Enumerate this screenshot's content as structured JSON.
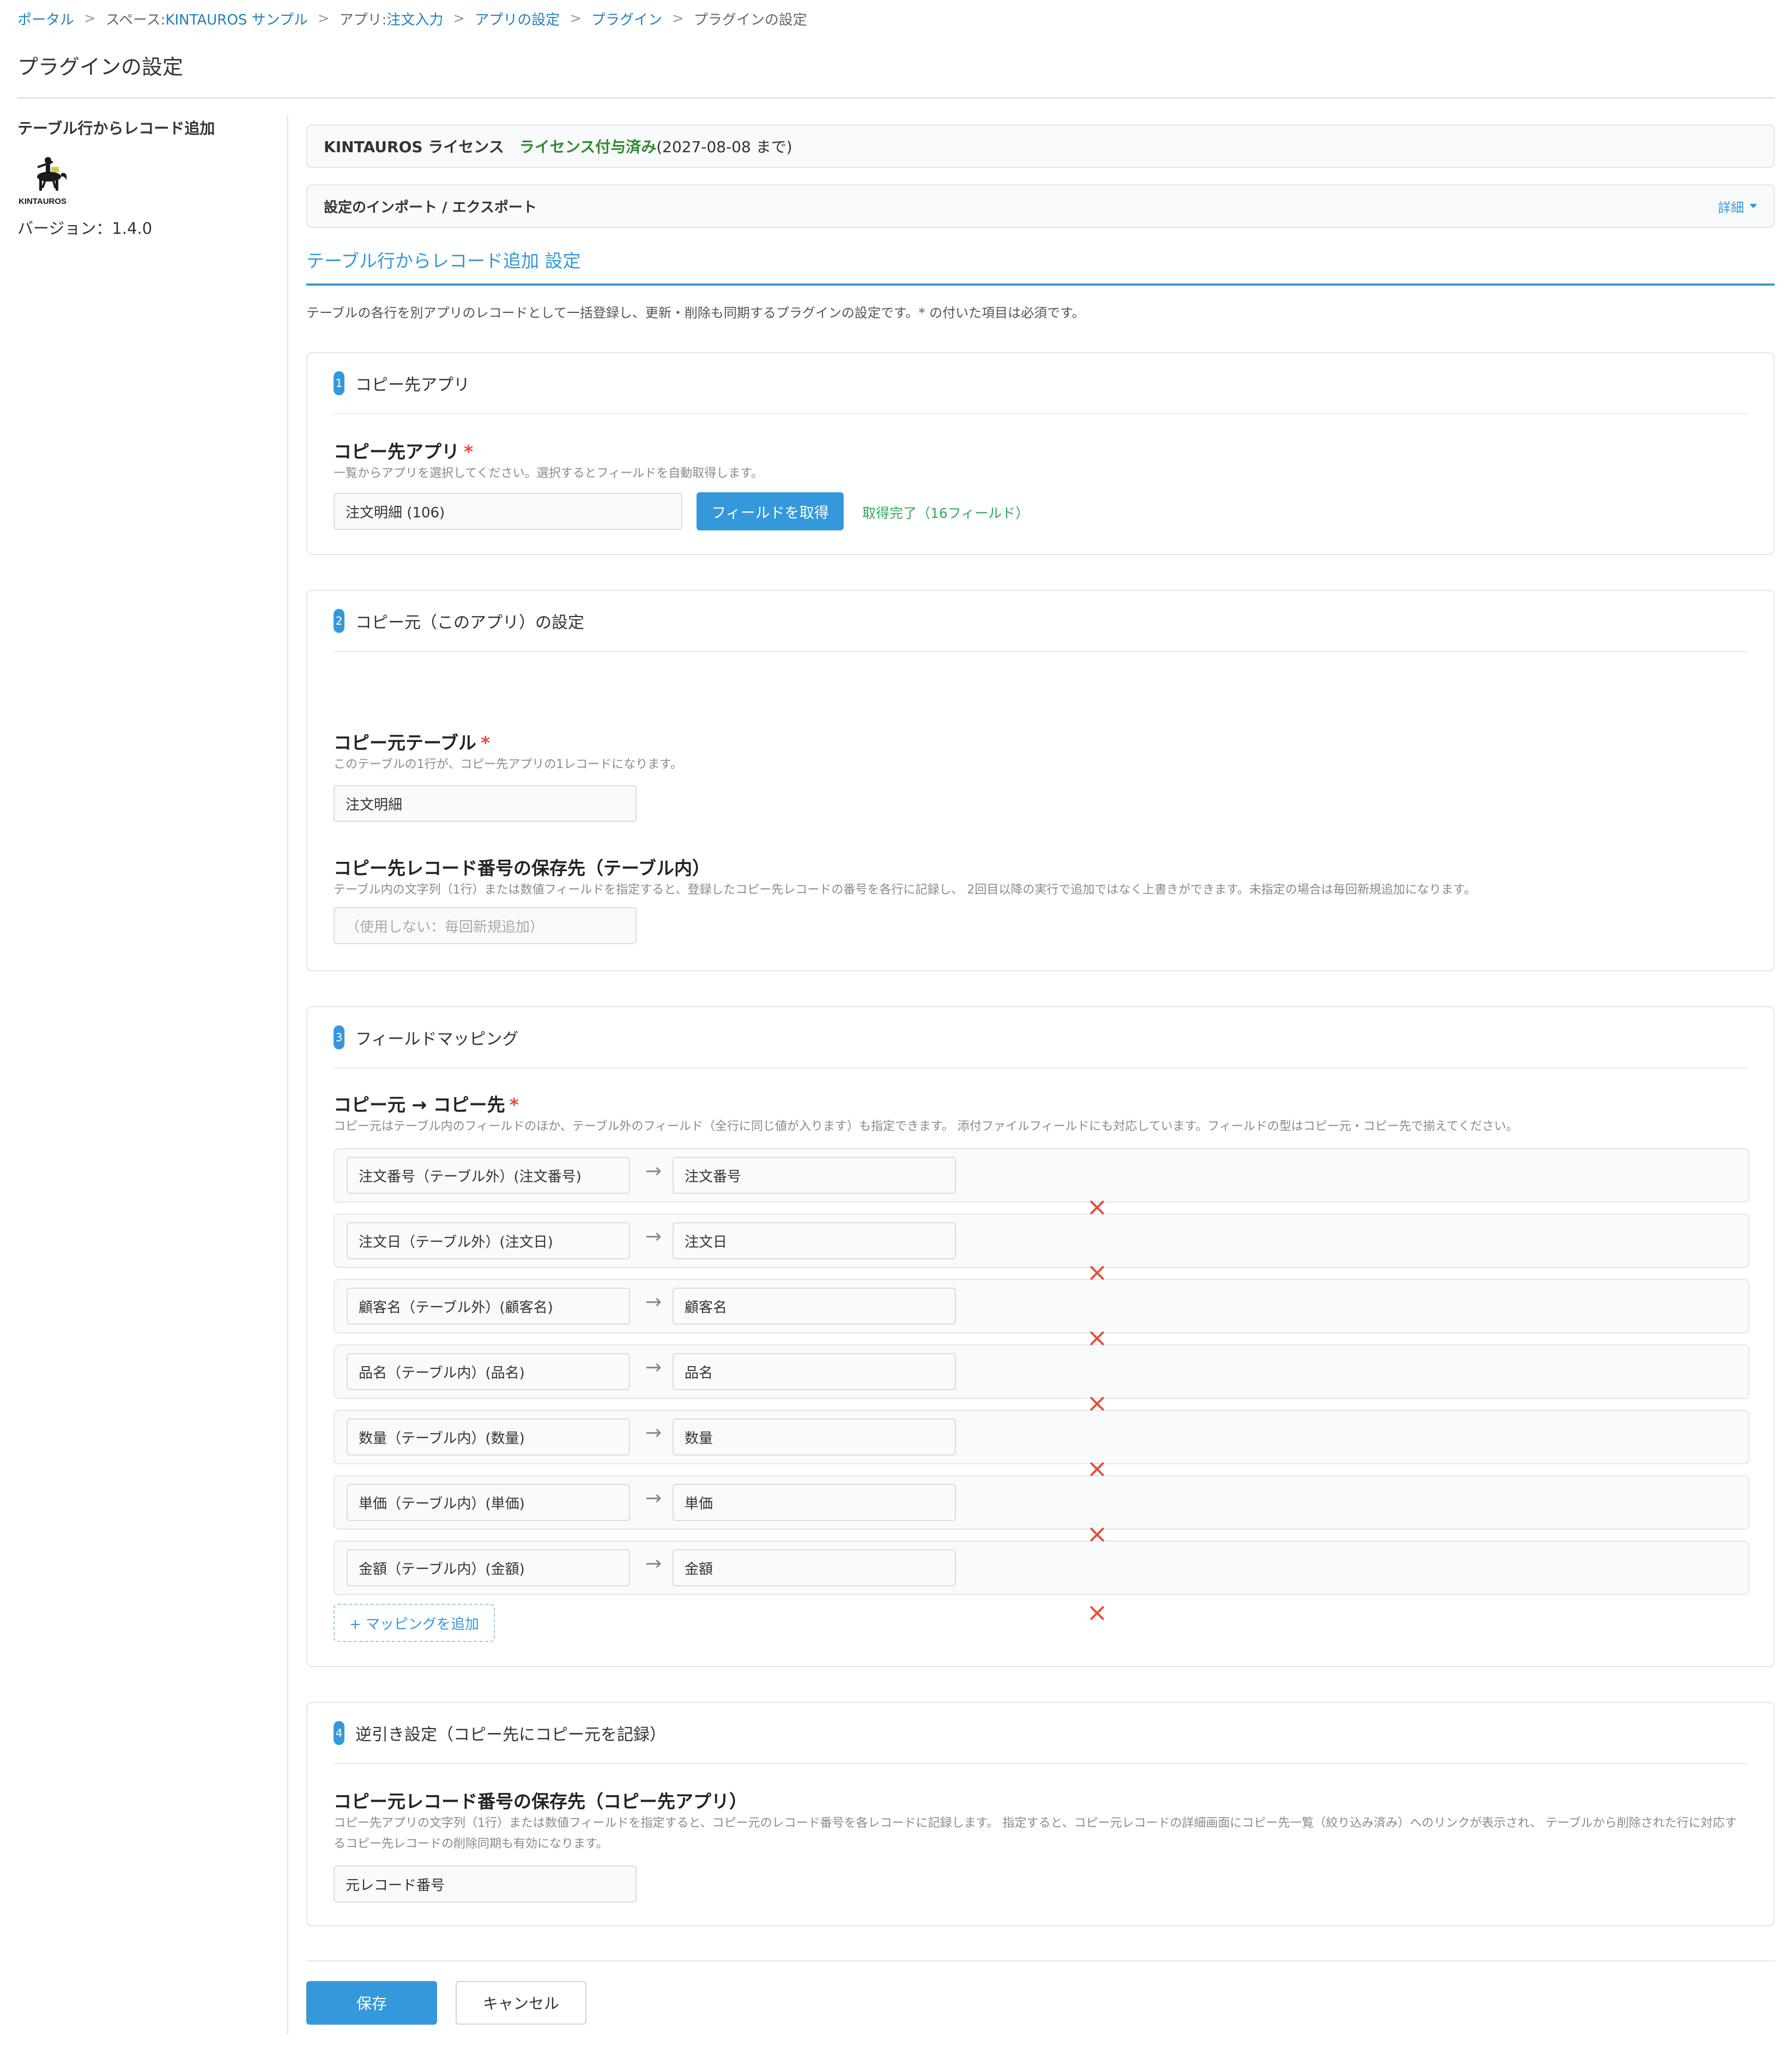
{
  "breadcrumb": {
    "portal": "ポータル",
    "sep": ">",
    "space_prefix": "スペース: ",
    "space_name": "KINTAUROS サンプル",
    "app_prefix": "アプリ: ",
    "app_name": "注文入力",
    "app_settings": "アプリの設定",
    "plugins": "プラグイン",
    "current": "プラグインの設定"
  },
  "page_title": "プラグインの設定",
  "sidebar": {
    "plugin_name": "テーブル行からレコード追加",
    "logo_text": "KINTAUROS",
    "version": "バージョン：1.4.0"
  },
  "license": {
    "name": "KINTAUROS ライセンス",
    "status": "ライセンス付与済み",
    "date": "(2027-08-08 まで)"
  },
  "import_export": {
    "label": "設定のインポート / エクスポート",
    "detail": "詳細"
  },
  "settings": {
    "heading": "テーブル行からレコード追加 設定",
    "description": "テーブルの各行を別アプリのレコードとして一括登録し、更新・削除も同期するプラグインの設定です。* の付いた項目は必須です。"
  },
  "section1": {
    "num": "1",
    "title": "コピー先アプリ",
    "label": "コピー先アプリ",
    "required": "*",
    "help": "一覧からアプリを選択してください。選択するとフィールドを自動取得します。",
    "app_value": "注文明細 (106)",
    "fetch_button": "フィールドを取得",
    "fetch_status": "取得完了（16フィールド）"
  },
  "section2": {
    "num": "2",
    "title": "コピー元（このアプリ）の設定",
    "table_label": "コピー元テーブル",
    "required": "*",
    "table_help": "このテーブルの1行が、コピー先アプリの1レコードになります。",
    "table_value": "注文明細",
    "store_label": "コピー先レコード番号の保存先（テーブル内）",
    "store_help": "テーブル内の文字列（1行）または数値フィールドを指定すると、登録したコピー先レコードの番号を各行に記録し、 2回目以降の実行で追加ではなく上書きができます。未指定の場合は毎回新規追加になります。",
    "store_placeholder": "（使用しない：毎回新規追加）"
  },
  "section3": {
    "num": "3",
    "title": "フィールドマッピング",
    "label": "コピー元 → コピー先",
    "required": "*",
    "help": "コピー元はテーブル内のフィールドのほか、テーブル外のフィールド（全行に同じ値が入ります）も指定できます。 添付ファイルフィールドにも対応しています。フィールドの型はコピー元・コピー先で揃えてください。",
    "arrow": "→",
    "mappings": [
      {
        "source": "注文番号（テーブル外）(注文番号)",
        "target": "注文番号"
      },
      {
        "source": "注文日（テーブル外）(注文日)",
        "target": "注文日"
      },
      {
        "source": "顧客名（テーブル外）(顧客名)",
        "target": "顧客名"
      },
      {
        "source": "品名（テーブル内）(品名)",
        "target": "品名"
      },
      {
        "source": "数量（テーブル内）(数量)",
        "target": "数量"
      },
      {
        "source": "単価（テーブル内）(単価)",
        "target": "単価"
      },
      {
        "source": "金額（テーブル内）(金額)",
        "target": "金額"
      }
    ],
    "add_button": "+ マッピングを追加"
  },
  "section4": {
    "num": "4",
    "title": "逆引き設定（コピー先にコピー元を記録）",
    "label": "コピー元レコード番号の保存先（コピー先アプリ）",
    "help": "コピー先アプリの文字列（1行）または数値フィールドを指定すると、コピー元のレコード番号を各レコードに記録します。 指定すると、コピー元レコードの詳細画面にコピー先一覧（絞り込み済み）へのリンクが表示され、 テーブルから削除された行に対応するコピー先レコードの削除同期も有効になります。",
    "value": "元レコード番号"
  },
  "footer": {
    "save": "保存",
    "cancel": "キャンセル"
  },
  "colors": {
    "accent": "#3498db",
    "license_ok": "#2e8b2e",
    "fetch_ok": "#2eaa5c",
    "danger": "#e74c3c"
  }
}
